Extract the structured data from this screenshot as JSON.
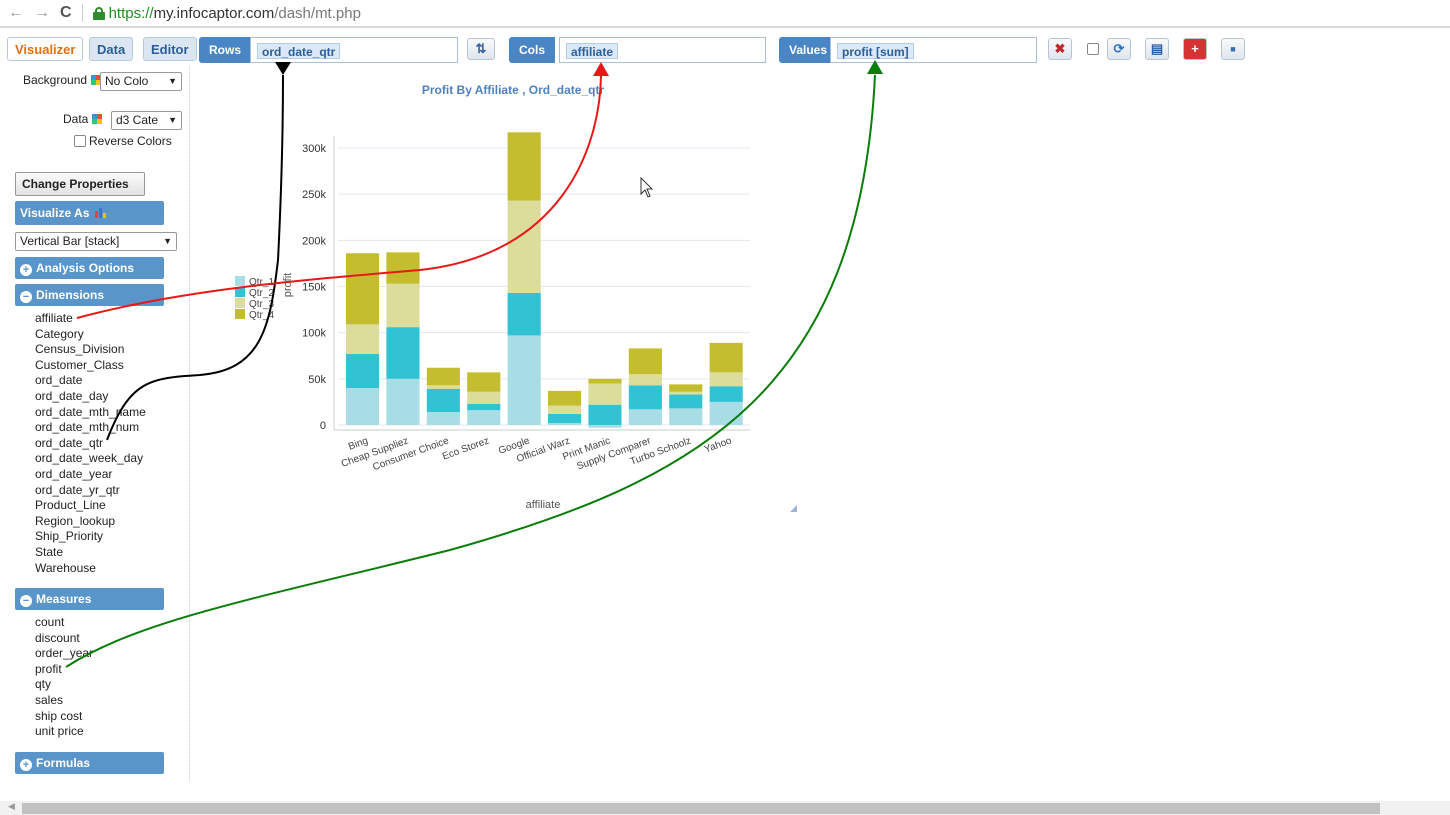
{
  "browser": {
    "url_scheme": "https://",
    "url_host": "my.infocaptor.com",
    "url_path": "/dash/mt.php"
  },
  "tabs": [
    {
      "label": "Visualizer",
      "active": true
    },
    {
      "label": "Data",
      "active": false
    },
    {
      "label": "Editor",
      "active": false
    }
  ],
  "shelves": {
    "rows_label": "Rows",
    "rows_value": "ord_date_qtr",
    "cols_label": "Cols",
    "cols_value": "affiliate",
    "values_label": "Values",
    "values_value": "profit [sum]"
  },
  "toolbar_icons": [
    "clear-icon",
    "refresh-icon",
    "save-icon",
    "add-icon",
    "image-icon"
  ],
  "panel": {
    "background_label": "Background",
    "background_value": "No Colo",
    "data_label": "Data",
    "data_value": "d3 Cate",
    "reverse_colors": "Reverse Colors",
    "change_properties": "Change Properties",
    "visualize_as": "Visualize As",
    "chart_type": "Vertical Bar [stack]",
    "analysis_options": "Analysis Options",
    "dimensions": "Dimensions",
    "measures": "Measures",
    "formulas": "Formulas"
  },
  "dimensions": [
    "affiliate",
    "Category",
    "Census_Division",
    "Customer_Class",
    "ord_date",
    "ord_date_day",
    "ord_date_mth_name",
    "ord_date_mth_num",
    "ord_date_qtr",
    "ord_date_week_day",
    "ord_date_year",
    "ord_date_yr_qtr",
    "Product_Line",
    "Region_lookup",
    "Ship_Priority",
    "State",
    "Warehouse"
  ],
  "measures": [
    "count",
    "discount",
    "order_year",
    "profit",
    "qty",
    "sales",
    "ship cost",
    "unit price"
  ],
  "chart_data": {
    "type": "bar",
    "stacked": true,
    "title": "Profit By Affiliate , Ord_date_qtr",
    "xlabel": "affiliate",
    "ylabel": "profit",
    "ylim": [
      0,
      300000
    ],
    "yticks": [
      "0",
      "50k",
      "100k",
      "150k",
      "200k",
      "250k",
      "300k"
    ],
    "grid": true,
    "legend_position": "top-left",
    "categories": [
      "Bing",
      "Cheap Suppliez",
      "Consumer Choice",
      "Eco Storez",
      "Google",
      "Official Warz",
      "Print Manic",
      "Supply Comparer",
      "Turbo Schoolz",
      "Yahoo"
    ],
    "series": [
      {
        "name": "Qtr_1",
        "color": "#a8dde6",
        "values": [
          40000,
          50000,
          14000,
          16000,
          97000,
          2000,
          -3000,
          17000,
          18000,
          25000
        ]
      },
      {
        "name": "Qtr_2",
        "color": "#31c3d4",
        "values": [
          37000,
          56000,
          25000,
          7000,
          46000,
          10000,
          22000,
          26000,
          15000,
          17000
        ]
      },
      {
        "name": "Qtr_3",
        "color": "#dcdc9b",
        "values": [
          32000,
          47000,
          4000,
          13000,
          100000,
          9000,
          23000,
          12000,
          3000,
          15000
        ]
      },
      {
        "name": "Qtr_4",
        "color": "#c4bd2f",
        "values": [
          77000,
          34000,
          19000,
          21000,
          74000,
          16000,
          5000,
          28000,
          8000,
          32000
        ]
      }
    ]
  },
  "annotation_colors": {
    "rows": "#000000",
    "cols": "#e81818",
    "values": "#0a7d0a"
  }
}
